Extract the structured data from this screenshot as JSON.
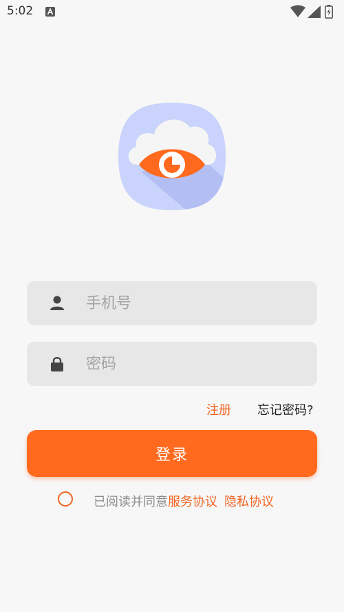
{
  "status_bar": {
    "time": "5:02",
    "icons": [
      "a-notification-icon",
      "wifi-icon",
      "signal-icon",
      "battery-icon"
    ]
  },
  "logo": {
    "icon": "cloud-eye-logo-icon",
    "colors": {
      "background": "#c9d3fb",
      "cloud": "#f5f5f5",
      "eye": "#ff6a1f"
    }
  },
  "form": {
    "phone": {
      "icon": "user-icon",
      "placeholder": "手机号",
      "value": ""
    },
    "password": {
      "icon": "lock-icon",
      "placeholder": "密码",
      "value": ""
    },
    "register_label": "注册",
    "forgot_label": "忘记密码?",
    "login_label": "登录"
  },
  "agreement": {
    "checked": false,
    "prefix": "已阅读并同意",
    "service_label": "服务协议",
    "privacy_label": "隐私协议"
  },
  "colors": {
    "accent": "#ff6a1f",
    "link": "#f26522",
    "field_bg": "#e7e7e7",
    "page_bg": "#f7f7f7"
  }
}
